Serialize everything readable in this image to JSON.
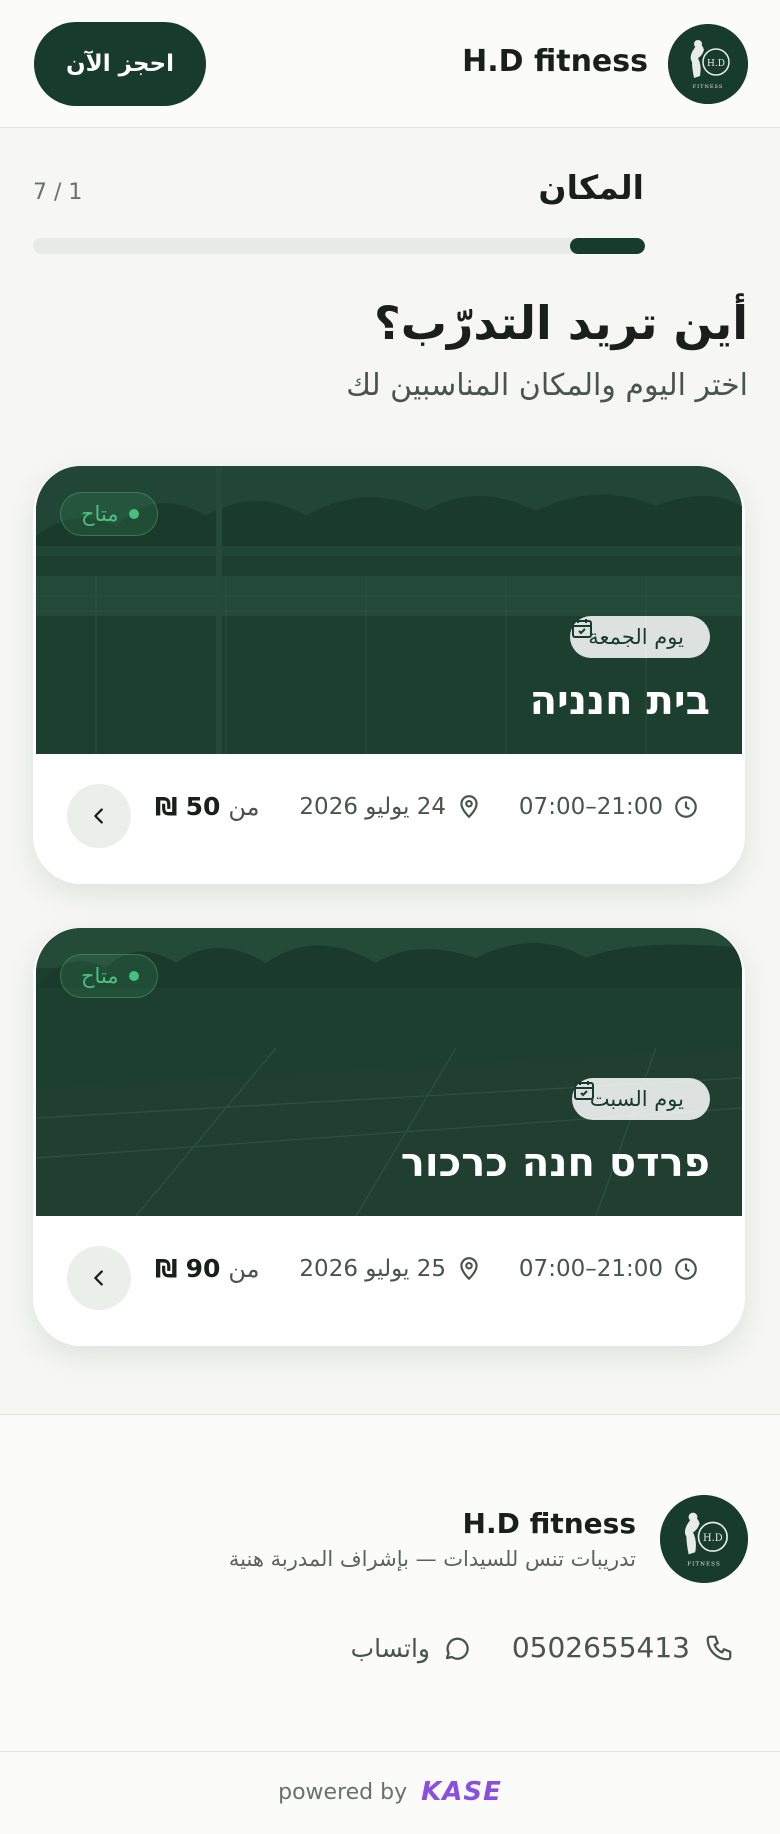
{
  "header": {
    "brand": "H.D fitness",
    "book_button": "احجز الآن"
  },
  "step": {
    "title": "المكان",
    "counter": "7 / 1",
    "progress_fraction": 0.1225
  },
  "page": {
    "title": "أين تريد التدرّب؟",
    "subtitle": "اختر اليوم والمكان المناسبين لك"
  },
  "cards": [
    {
      "status": "متاح",
      "day": "يوم الجمعة",
      "place": "בית חנניה",
      "hours": "07:00–21:00",
      "date": "24 يوليو 2026",
      "price_prefix": "من",
      "price_value": "50",
      "currency": "₪"
    },
    {
      "status": "متاح",
      "day": "يوم السبت",
      "place": "פרדס חנה כרכור",
      "hours": "07:00–21:00",
      "date": "25 يوليو 2026",
      "price_prefix": "من",
      "price_value": "90",
      "currency": "₪"
    }
  ],
  "footer": {
    "brand": "H.D fitness",
    "tagline": "تدريبات تنس للسيدات — بإشراف المدربة هنية",
    "phone": "0502655413",
    "whatsapp": "واتساب",
    "powered_by": "powered by",
    "powered_brand": "KASE"
  },
  "colors": {
    "primary": "#173b2c",
    "background": "#f6f7f3",
    "available": "#46c07a",
    "kase": "#8b4fe0"
  }
}
